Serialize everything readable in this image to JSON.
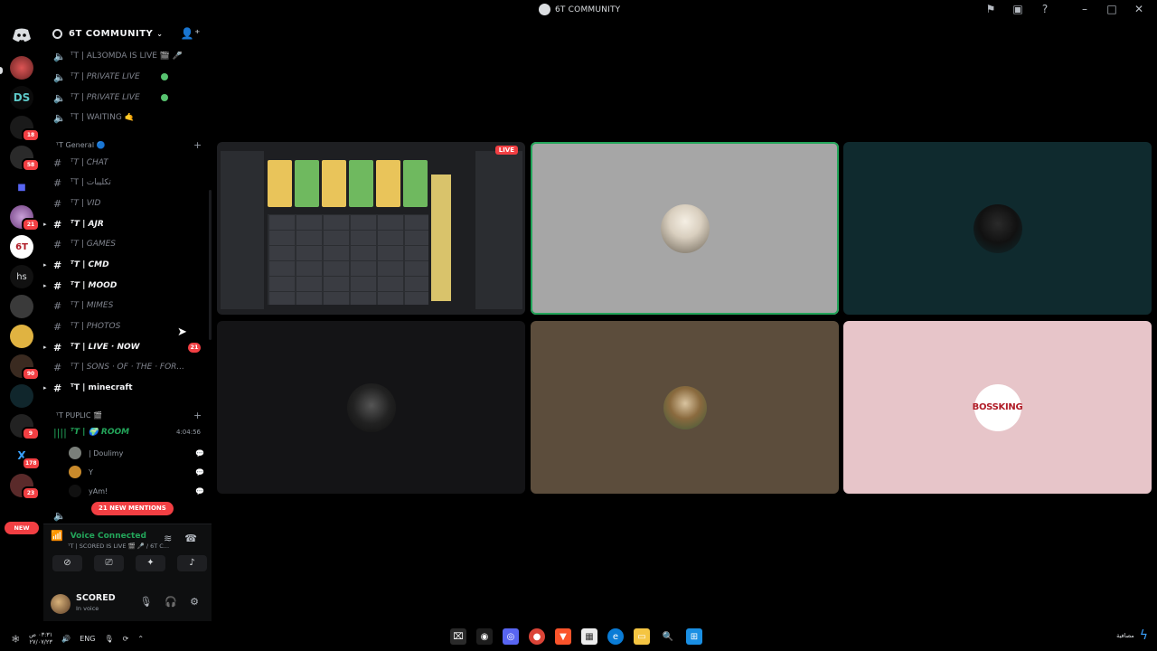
{
  "window": {
    "title": "6T COMMUNITY"
  },
  "server_badges": [
    "18",
    "58",
    "21",
    "90",
    "9",
    "178",
    "23"
  ],
  "server_new_label": "NEW",
  "guild": {
    "name": "6T COMMUNITY"
  },
  "channels_top": [
    {
      "name": "ᵀT | AL3OMDA IS LIVE 🎬 🎤"
    },
    {
      "name": "ᵀT | PRIVATE LIVE"
    },
    {
      "name": "ᵀT | PRIVATE LIVE"
    },
    {
      "name": "ᵀT | WAITING 🤙"
    }
  ],
  "category_general": "ᵀT General 🔵",
  "text_channels": [
    {
      "name": "ᵀT | CHAT"
    },
    {
      "name": "ᵀT | تكليبات"
    },
    {
      "name": "ᵀT | VID"
    },
    {
      "name": "ᵀT | AJR"
    },
    {
      "name": "ᵀT | GAMES"
    },
    {
      "name": "ᵀT | CMD"
    },
    {
      "name": "ᵀT | MOOD"
    },
    {
      "name": "ᵀT | MIMES"
    },
    {
      "name": "ᵀT | PHOTOS"
    },
    {
      "name": "ᵀT | LIVE · NOW",
      "badge": "21"
    },
    {
      "name": "ᵀT | SONS · OF · THE · FOR..."
    },
    {
      "name": "ᵀT | minecraft"
    }
  ],
  "category_public": "ᵀT PUPLIC 🎬",
  "voice_channel": {
    "name": "ᵀT | 🌍 ROOM",
    "time": "4:04:56",
    "members": [
      "| Doulimy",
      "Y",
      "yAm!"
    ]
  },
  "new_mentions": "21 NEW MENTIONS",
  "voice_panel": {
    "status": "Voice Connected",
    "channel": "ᵀT | SCORED IS LIVE 🎬 🎤 / 6T C..."
  },
  "user": {
    "name": "SCORED",
    "status": "In voice"
  },
  "stream": {
    "live_label": "LIVE"
  },
  "tiles": [
    {
      "bg": "#a6a6a6",
      "border": "#23a55a"
    },
    {
      "bg": "#0f2a2e"
    },
    {
      "bg": "#141416"
    },
    {
      "bg": "#5c4d3c"
    },
    {
      "bg": "#e7c5c9",
      "text": "BOSSKING"
    }
  ],
  "taskbar": {
    "lang": "ENG",
    "clock_time": "٠٣:٣١ ص",
    "clock_date": "٢٧/٠٧/٢٣",
    "right_text": "مصافية"
  }
}
